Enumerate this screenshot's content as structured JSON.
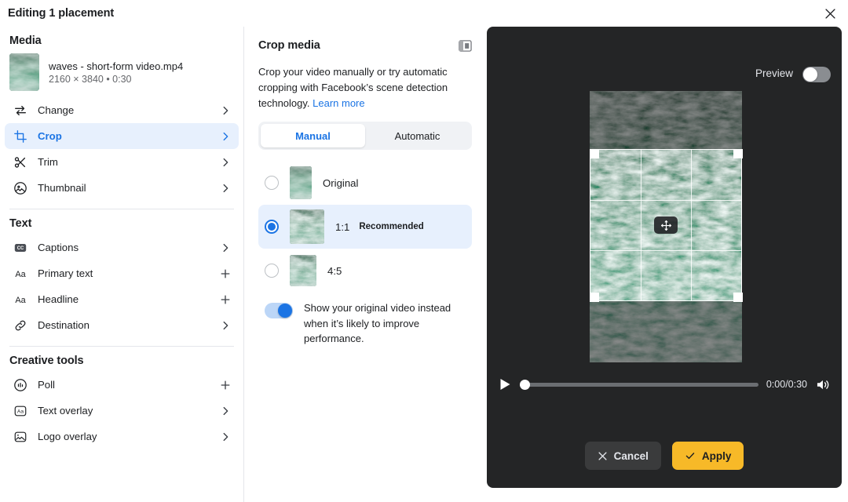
{
  "window": {
    "title": "Editing 1 placement",
    "close_icon": "close-icon"
  },
  "sidebar": {
    "media_section": {
      "title": "Media",
      "file_name": "waves - short-form video.mp4",
      "file_meta": "2160 × 3840 • 0:30"
    },
    "media_items": [
      {
        "label": "Change",
        "icon": "swap-arrows-icon",
        "trailing": "chevron-right-icon",
        "active": false
      },
      {
        "label": "Crop",
        "icon": "crop-icon",
        "trailing": "chevron-right-icon",
        "active": true
      },
      {
        "label": "Trim",
        "icon": "scissors-icon",
        "trailing": "chevron-right-icon",
        "active": false
      },
      {
        "label": "Thumbnail",
        "icon": "photo-circle-icon",
        "trailing": "chevron-right-icon",
        "active": false
      }
    ],
    "text_section": {
      "title": "Text"
    },
    "text_items": [
      {
        "label": "Captions",
        "icon": "closed-caption-icon",
        "trailing": "chevron-right-icon"
      },
      {
        "label": "Primary text",
        "icon": "text-aa-icon",
        "trailing": "plus-icon"
      },
      {
        "label": "Headline",
        "icon": "text-aa-icon",
        "trailing": "plus-icon"
      },
      {
        "label": "Destination",
        "icon": "link-icon",
        "trailing": "chevron-right-icon"
      }
    ],
    "creative_section": {
      "title": "Creative tools"
    },
    "creative_items": [
      {
        "label": "Poll",
        "icon": "poll-bars-icon",
        "trailing": "plus-icon"
      },
      {
        "label": "Text overlay",
        "icon": "text-box-icon",
        "trailing": "chevron-right-icon"
      },
      {
        "label": "Logo overlay",
        "icon": "image-overlay-icon",
        "trailing": "chevron-right-icon"
      }
    ]
  },
  "crop_panel": {
    "title": "Crop media",
    "panel_toggle_icon": "side-panel-icon",
    "description_before": "Crop your video manually or try automatic cropping with Facebook’s scene detection technology. ",
    "learn_more": "Learn more",
    "tabs": [
      {
        "label": "Manual",
        "selected": true
      },
      {
        "label": "Automatic",
        "selected": false
      }
    ],
    "options": [
      {
        "label": "Original",
        "badge": "",
        "selected": false,
        "thumb_w": 28,
        "thumb_h": 42
      },
      {
        "label": "1:1",
        "badge": "Recommended",
        "selected": true,
        "thumb_w": 44,
        "thumb_h": 44
      },
      {
        "label": "4:5",
        "badge": "",
        "selected": false,
        "thumb_w": 34,
        "thumb_h": 40
      }
    ],
    "toggle": {
      "text": "Show your original video instead when it’s likely to improve performance.",
      "on": true
    }
  },
  "preview": {
    "toggle_label": "Preview",
    "toggle_on": false,
    "move_handle_icon": "move-arrows-icon",
    "player": {
      "play_icon": "play-icon",
      "time": "0:00/0:30",
      "progress_percent": 0,
      "volume_icon": "volume-on-icon"
    },
    "buttons": {
      "cancel": {
        "label": "Cancel",
        "icon": "close-icon"
      },
      "apply": {
        "label": "Apply",
        "icon": "check-icon"
      }
    }
  },
  "colors": {
    "accent_blue": "#1b74e4",
    "apply_yellow": "#f7b928",
    "panel_dark": "#242526",
    "text_primary": "#1c1e21",
    "text_secondary": "#65676b"
  }
}
